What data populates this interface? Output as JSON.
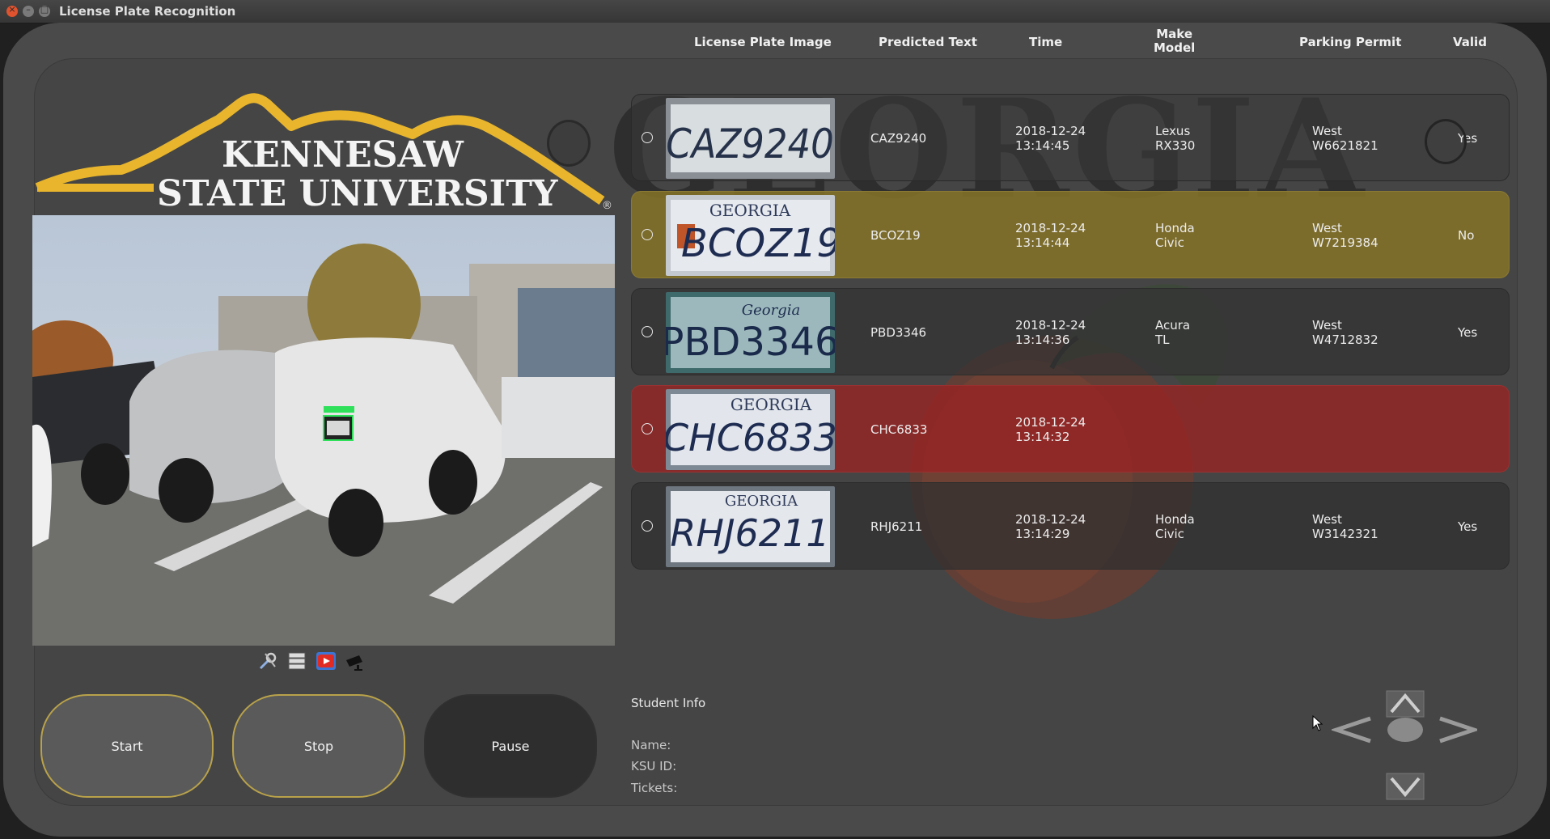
{
  "window": {
    "title": "License Plate Recognition"
  },
  "table": {
    "headers": {
      "image": "License Plate Image",
      "predicted": "Predicted Text",
      "time": "Time",
      "make": "Make",
      "model": "Model",
      "permit": "Parking Permit",
      "valid": "Valid"
    },
    "rows": [
      {
        "plate": "CAZ9240",
        "state": "",
        "predicted": "CAZ9240",
        "date": "2018-12-24",
        "clock": "13:14:45",
        "make": "Lexus",
        "model": "RX330",
        "permit_zone": "West",
        "permit_id": "W6621821",
        "valid": "Yes",
        "status": "ok"
      },
      {
        "plate": "BCOZ19",
        "state": "GEORGIA",
        "predicted": "BCOZ19",
        "date": "2018-12-24",
        "clock": "13:14:44",
        "make": "Honda",
        "model": "Civic",
        "permit_zone": "West",
        "permit_id": "W7219384",
        "valid": "No",
        "status": "invalid"
      },
      {
        "plate": "PBD3346",
        "state": "Georgia",
        "predicted": "PBD3346",
        "date": "2018-12-24",
        "clock": "13:14:36",
        "make": "Acura",
        "model": "TL",
        "permit_zone": "West",
        "permit_id": "W4712832",
        "valid": "Yes",
        "status": "ok"
      },
      {
        "plate": "CHC6833",
        "state": "GEORGIA",
        "predicted": "CHC6833",
        "date": "2018-12-24",
        "clock": "13:14:32",
        "make": "",
        "model": "",
        "permit_zone": "",
        "permit_id": "",
        "valid": "",
        "status": "unknown"
      },
      {
        "plate": "RHJ6211",
        "state": "GEORGIA",
        "predicted": "RHJ6211",
        "date": "2018-12-24",
        "clock": "13:14:29",
        "make": "Honda",
        "model": "Civic",
        "permit_zone": "West",
        "permit_id": "W3142321",
        "valid": "Yes",
        "status": "ok"
      }
    ]
  },
  "logo": {
    "line1": "KENNESAW",
    "line2": "STATE UNIVERSITY",
    "reg": "®"
  },
  "background_text": "GEORGIA",
  "camera": {
    "detected_plate": "CAZ9240"
  },
  "toolbar_icons": [
    "settings-icon",
    "database-icon",
    "youtube-icon",
    "camera-icon"
  ],
  "buttons": {
    "start": "Start",
    "stop": "Stop",
    "pause": "Pause"
  },
  "student": {
    "title": "Student Info",
    "name": "Name:",
    "ksu_id": "KSU ID:",
    "tickets": "Tickets:"
  },
  "colors": {
    "invalid_row": "#776828",
    "unknown_row": "#8b2727",
    "row_default": "#3d3d3d",
    "accent_border": "#b9a24a",
    "logo_gold": "#e8b52c"
  }
}
